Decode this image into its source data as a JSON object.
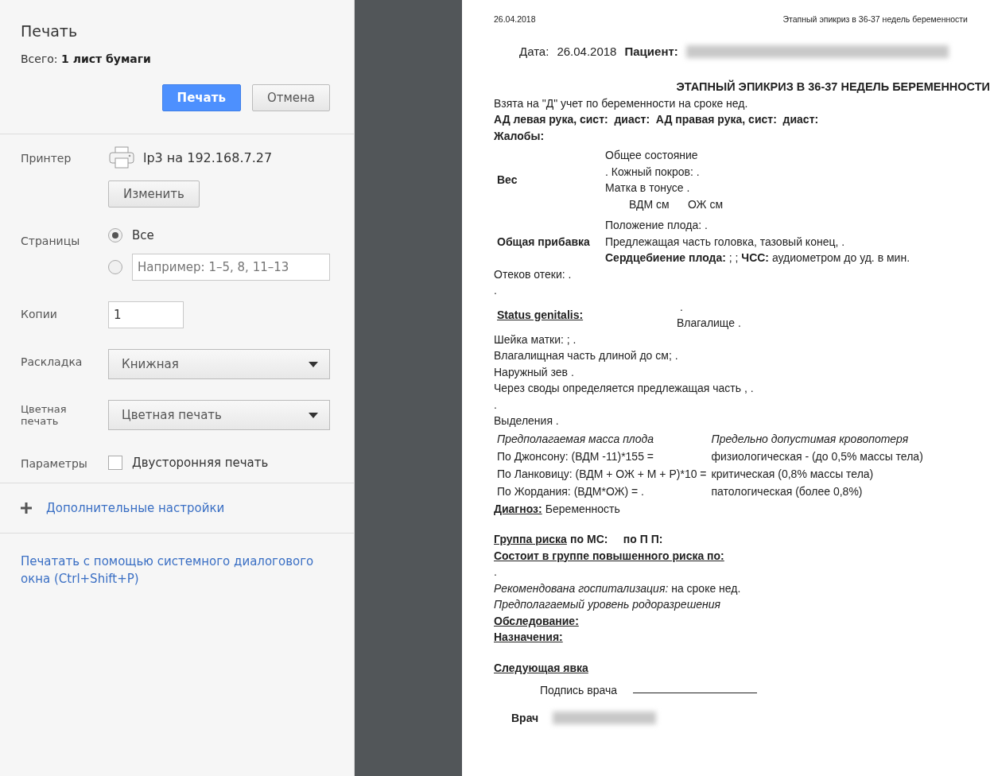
{
  "sidebar": {
    "title": "Печать",
    "summary": "Всего: **1 лист бумаги**",
    "buttons": [
      {
        "label": "Печать",
        "kind": "primary"
      },
      {
        "label": "Отмена",
        "kind": "secondary"
      }
    ],
    "settings": [
      {
        "label": "Принтер",
        "kind": "printer",
        "printer": "lp3 на 192.168.7.27",
        "button": "Изменить"
      },
      {
        "label": "Страницы",
        "kind": "radio",
        "options": [
          {
            "kind": "label",
            "text": "Все",
            "selected": true
          },
          {
            "kind": "input",
            "placeholder": "Например: 1–5, 8, 11–13",
            "selected": false
          }
        ]
      },
      {
        "label": "Копии",
        "kind": "number",
        "value": "1"
      },
      {
        "label": "Раскладка",
        "kind": "select",
        "value": "Книжная"
      },
      {
        "label": "Цветная печать",
        "kind": "select",
        "value": "Цветная печать"
      },
      {
        "label": "Параметры",
        "kind": "checkbox",
        "text": "Двусторонняя печать",
        "checked": false
      }
    ],
    "more_settings": "Дополнительные настройки",
    "system_dialog": "Печатать с помощью системного диалогового окна (Ctrl+Shift+P)"
  },
  "preview": {
    "header_date": "26.04.2018",
    "header_title": "Этапный эпикриз в 36-37 недель беременности",
    "date_label": "Дата:",
    "date": "26.04.2018",
    "patient_label": "Пациент:",
    "heading": "ЭТАПНЫЙ ЭПИКРИЗ В 36-37 НЕДЕЛЬ БЕРЕМЕННОСТИ",
    "blocks": [
      {
        "kind": "line",
        "text": "Взята на \"Д\" учет по беременности на сроке нед."
      },
      {
        "kind": "bold",
        "text": "АД левая рука, сист:  диаст:  АД правая рука, сист:  диаст:"
      },
      {
        "kind": "bold",
        "text": "Жалобы:"
      },
      {
        "kind": "exam",
        "label": "Вес",
        "lines": [
          "Общее состояние",
          ". Кожный покров: .",
          "Матка в тонусе .",
          "ВДМ см      ОЖ см"
        ]
      },
      {
        "kind": "exam",
        "label": "Общая прибавка",
        "lines": [
          "Положение плода: .",
          "Предлежащая часть головка, тазовый конец, .",
          "**Сердцебиение плода:** ; ; **ЧСС:** аудиометром до уд. в мин."
        ]
      },
      {
        "kind": "line",
        "text": "Отеков отеки: ."
      },
      {
        "kind": "line",
        "text": "."
      },
      {
        "kind": "status",
        "label": "Status genitalis:",
        "lines": [
          ".",
          "Влагалище ."
        ]
      },
      {
        "kind": "line",
        "text": "Шейка матки: ; ."
      },
      {
        "kind": "line",
        "text": "Влагалищная часть длиной до см; ."
      },
      {
        "kind": "line",
        "text": "Наружный зев ."
      },
      {
        "kind": "line",
        "text": "Через своды определяется предлежащая часть , ."
      },
      {
        "kind": "line",
        "text": "."
      },
      {
        "kind": "line",
        "text": "Выделения ."
      },
      {
        "kind": "table",
        "rows": [
          [
            "Предполагаемая масса плода",
            "Предельно допустимая кровопотеря"
          ],
          [
            "По Джонсону: (ВДМ -11)*155 =",
            "физиологическая - (до 0,5% массы тела)"
          ],
          [
            "По Ланковицу: (ВДМ + ОЖ + М + Р)*10 =",
            "критическая (0,8% массы тела)"
          ],
          [
            "По Жордания: (ВДМ*ОЖ) = .",
            "патологическая (более 0,8%)"
          ]
        ]
      },
      {
        "kind": "underlined",
        "lead": "Диагноз:",
        "text": "Беременность"
      },
      {
        "kind": "blank"
      },
      {
        "kind": "underlined",
        "lead": "Группа риска",
        "text": "**по МС:     по П П:**"
      },
      {
        "kind": "underlined",
        "lead": "Состоит в группе повышенного риска по:"
      },
      {
        "kind": "line",
        "text": "."
      },
      {
        "kind": "line",
        "text": "*Рекомендована госпитализация:* на сроке нед."
      },
      {
        "kind": "italic",
        "text": "Предполагаемый уровень родоразрешения"
      },
      {
        "kind": "underlined",
        "lead": "Обследование:"
      },
      {
        "kind": "underlined",
        "lead": "Назначения:"
      },
      {
        "kind": "blank"
      },
      {
        "kind": "underlined",
        "lead": "Следующая явка"
      },
      {
        "kind": "signature",
        "text": "Подпись врача"
      },
      {
        "kind": "doctor",
        "text": "Врач"
      }
    ]
  }
}
